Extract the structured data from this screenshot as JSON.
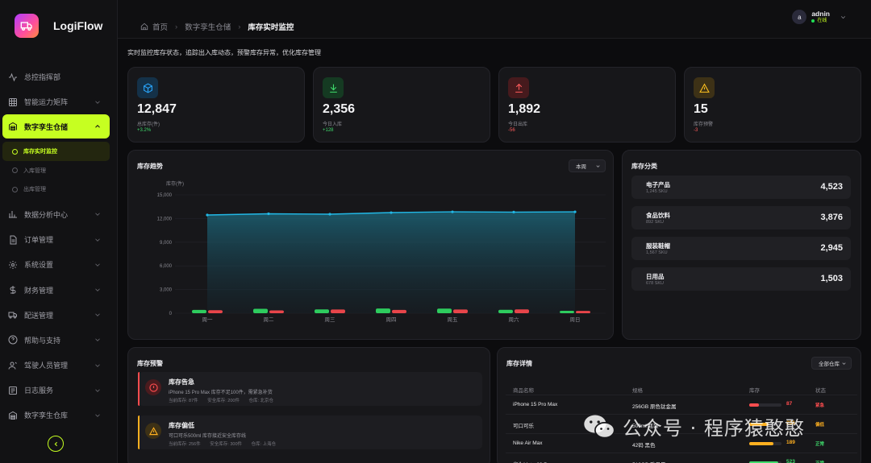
{
  "app": {
    "name": "LogiFlow"
  },
  "sidebar": {
    "items": [
      {
        "label": "总控指挥部",
        "icon": "activity-icon"
      },
      {
        "label": "智能运力矩阵",
        "icon": "grid-icon"
      },
      {
        "label": "数字孪生仓储",
        "icon": "warehouse-icon",
        "active": true
      },
      {
        "label": "数据分析中心",
        "icon": "bar-chart-icon"
      },
      {
        "label": "订单管理",
        "icon": "document-icon"
      },
      {
        "label": "系统设置",
        "icon": "gear-icon"
      },
      {
        "label": "财务管理",
        "icon": "dollar-icon"
      },
      {
        "label": "配送管理",
        "icon": "truck-icon"
      },
      {
        "label": "帮助与支持",
        "icon": "help-icon"
      },
      {
        "label": "驾驶人员管理",
        "icon": "user-icon"
      },
      {
        "label": "日志服务",
        "icon": "log-icon"
      },
      {
        "label": "数字孪生仓库",
        "icon": "warehouse-icon"
      }
    ],
    "sub_items": [
      {
        "label": "库存实时监控",
        "active": true
      },
      {
        "label": "入库管理"
      },
      {
        "label": "出库管理"
      }
    ]
  },
  "breadcrumb": [
    "首页",
    "数字孪生仓储",
    "库存实时监控"
  ],
  "user": {
    "initial": "a",
    "name": "adnin",
    "status": "在线"
  },
  "page": {
    "subtitle": "实时监控库存状态，追踪出入库动态，预警库存异常，优化库存管理"
  },
  "stats": [
    {
      "value": "12,847",
      "label": "总库存(件)",
      "delta": "+3.2%",
      "dir": "up",
      "icon": "cube-icon",
      "color": "#2aa8ff",
      "bg": "#143148"
    },
    {
      "value": "2,356",
      "label": "今日入库",
      "delta": "+128",
      "dir": "up",
      "icon": "download-icon",
      "color": "#3fdc6c",
      "bg": "#153a22"
    },
    {
      "value": "1,892",
      "label": "今日出库",
      "delta": "-56",
      "dir": "down",
      "icon": "upload-icon",
      "color": "#ff5c5c",
      "bg": "#461a1d"
    },
    {
      "value": "15",
      "label": "库存预警",
      "delta": "-3",
      "dir": "down",
      "icon": "warning-icon",
      "color": "#ffc21f",
      "bg": "#3d3116"
    }
  ],
  "trend": {
    "title": "库存趋势",
    "filter": "本周"
  },
  "chart_data": {
    "type": "area",
    "ylabel": "库存(件)",
    "ylim": [
      0,
      15000
    ],
    "yticks": [
      "15,000",
      "12,000",
      "9,000",
      "6,000",
      "3,000",
      "0"
    ],
    "categories": [
      "周一",
      "周二",
      "周三",
      "周四",
      "周五",
      "周六",
      "周日"
    ],
    "series": [
      {
        "values": [
          12450,
          12600,
          12550,
          12750,
          12850,
          12820,
          12847
        ],
        "color": "#22b8e6"
      },
      {
        "values": [
          420,
          560,
          480,
          600,
          590,
          430,
          300
        ],
        "color": "#2ecc5e"
      },
      {
        "values": [
          380,
          360,
          470,
          420,
          470,
          480,
          290
        ],
        "color": "#e8454a"
      }
    ],
    "grid": true,
    "legend": "none"
  },
  "category": {
    "title": "库存分类",
    "items": [
      {
        "name": "电子产品",
        "sku": "1,245 SKU",
        "value": "4,523"
      },
      {
        "name": "食品饮料",
        "sku": "892 SKU",
        "value": "3,876"
      },
      {
        "name": "服装鞋帽",
        "sku": "1,567 SKU",
        "value": "2,945"
      },
      {
        "name": "日用品",
        "sku": "678 SKU",
        "value": "1,503"
      }
    ]
  },
  "alerts": {
    "title": "库存预警",
    "items": [
      {
        "title": "库存告急",
        "desc": "iPhone 15 Pro Max 库存不足100件，需紧急补货",
        "current": "当前库存: 87件",
        "safe": "安全库存: 200件",
        "warehouse": "仓库: 北京仓",
        "color": "#ff4d4f",
        "bg": "#4a1b1e",
        "icon": "alert-circle-icon"
      },
      {
        "title": "库存偏低",
        "desc": "可口可乐500ml 库存接近安全库存线",
        "current": "当前库存: 256件",
        "safe": "安全库存: 300件",
        "warehouse": "仓库: 上海仓",
        "color": "#ffb020",
        "bg": "#3d3116",
        "icon": "warning-icon"
      }
    ]
  },
  "detail": {
    "title": "库存详情",
    "filter": "全部仓库",
    "headers": [
      "商品名称",
      "规格",
      "库存",
      "状态"
    ],
    "rows": [
      {
        "name": "iPhone 15 Pro Max",
        "spec": "256GB 原色钛金属",
        "qty": "87",
        "fill": 0.3,
        "color": "#ff4d4f",
        "status": "紧急"
      },
      {
        "name": "可口可乐",
        "spec": "500ml 瓶装",
        "qty": "256",
        "fill": 0.6,
        "color": "#ffb020",
        "status": "偏低"
      },
      {
        "name": "Nike Air Max",
        "spec": "42码 黑色",
        "qty": "189",
        "fill": 0.75,
        "color": "#ffb020",
        "status": "正常"
      },
      {
        "name": "华为Mate 60 Pro",
        "spec": "512GB 雅丹黑",
        "qty": "523",
        "fill": 0.9,
        "color": "#3fdc6c",
        "status": "正常"
      }
    ]
  },
  "watermark": {
    "text": "公众号 · 程序猿憨憨"
  }
}
